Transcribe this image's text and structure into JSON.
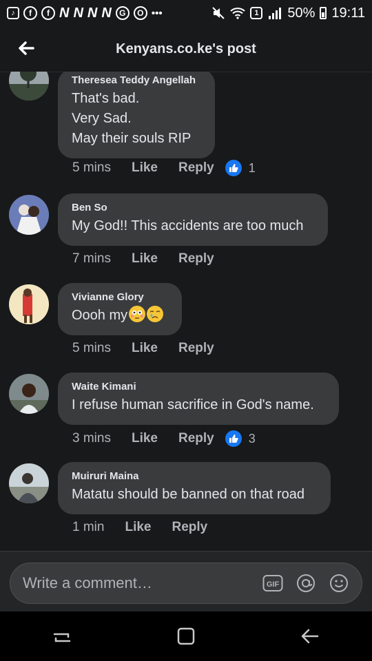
{
  "status_bar": {
    "battery": "50%",
    "time": "19:11",
    "sim_badge": "1",
    "left_icons": [
      "tiktok-icon",
      "facebook-icon",
      "facebook-icon",
      "n-icon",
      "n-icon",
      "n-icon",
      "n-icon",
      "chrome-icon",
      "opera-icon",
      "more-icon"
    ],
    "right_icons": [
      "mute-icon",
      "wifi-icon",
      "sim-icon",
      "signal-icon"
    ]
  },
  "header": {
    "title": "Kenyans.co.ke's post"
  },
  "comments": [
    {
      "author": "Theresea Teddy Angellah",
      "lines": [
        "That's bad.",
        "Very Sad.",
        "May their souls RIP"
      ],
      "time": "5 mins",
      "like": "Like",
      "reply": "Reply",
      "reactions": "1"
    },
    {
      "author": "Ben So",
      "lines": [
        "My God!! This accidents are too much"
      ],
      "time": "7 mins",
      "like": "Like",
      "reply": "Reply"
    },
    {
      "author": "Vivianne Glory",
      "lines": [
        "Oooh my"
      ],
      "emojis": [
        "flushed-face-emoji",
        "crying-face-emoji"
      ],
      "time": "5 mins",
      "like": "Like",
      "reply": "Reply"
    },
    {
      "author": "Waite Kimani",
      "lines": [
        "I refuse human sacrifice in God's name."
      ],
      "time": "3 mins",
      "like": "Like",
      "reply": "Reply",
      "reactions": "3"
    },
    {
      "author": "Muiruri Maina",
      "lines": [
        "Matatu should be banned on that road"
      ],
      "time": "1 min",
      "like": "Like",
      "reply": "Reply"
    }
  ],
  "composer": {
    "placeholder": "Write a comment…",
    "gif_label": "GIF"
  },
  "colors": {
    "background": "#18191a",
    "bubble": "#3a3b3c",
    "like_blue": "#1877f2"
  }
}
